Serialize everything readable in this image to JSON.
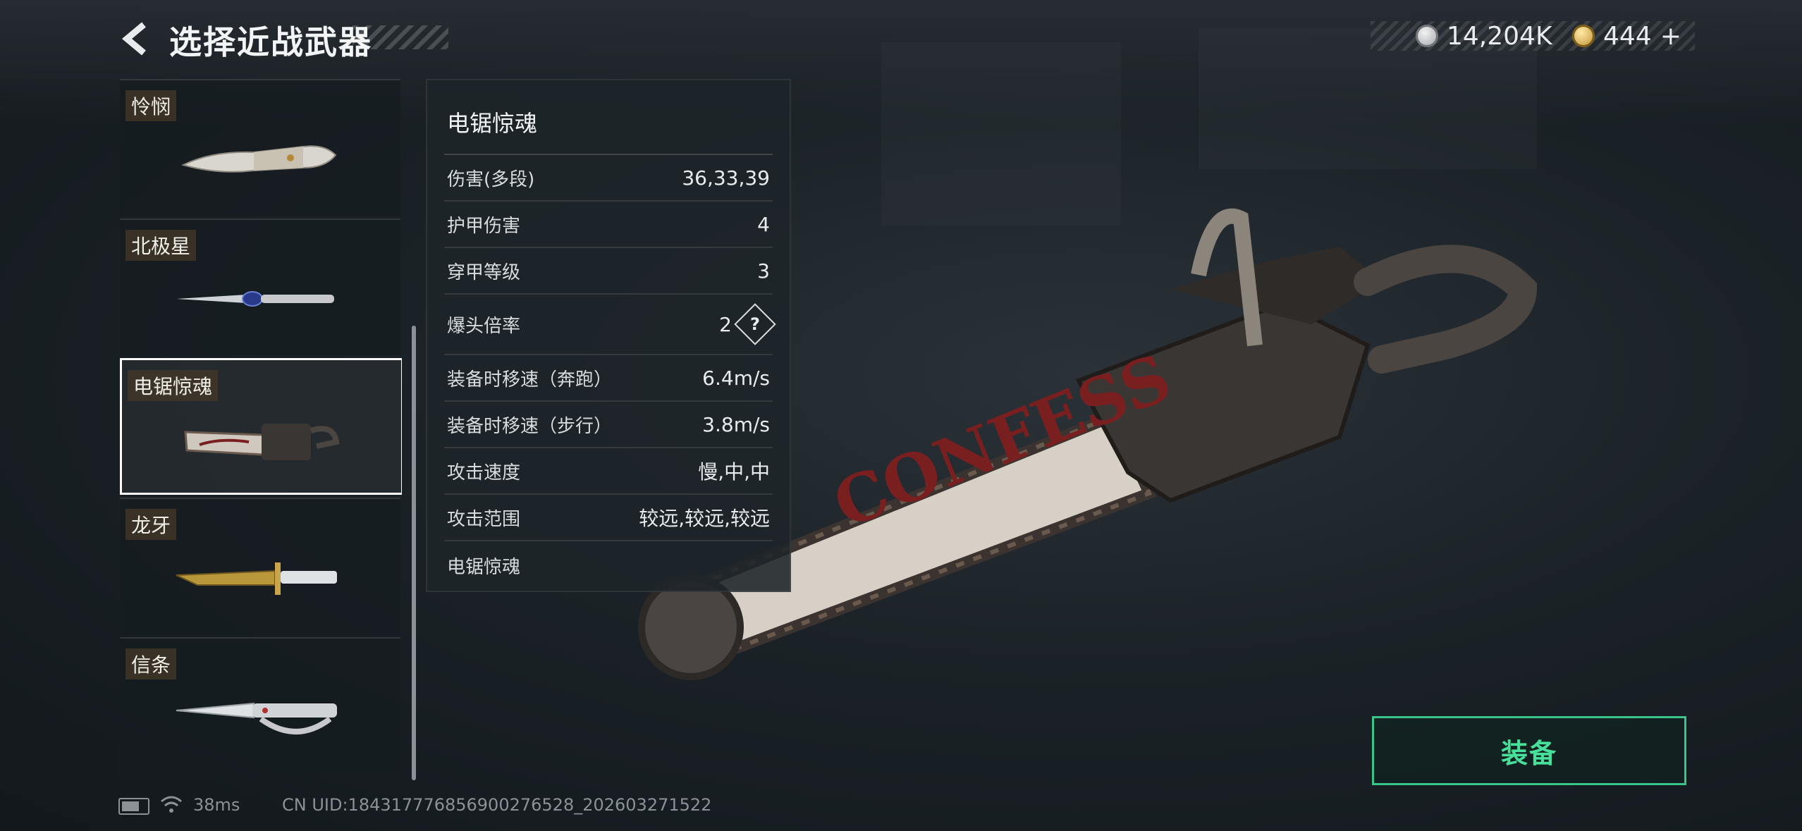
{
  "header": {
    "title": "选择近战武器"
  },
  "currency": {
    "silver": "14,204K",
    "gold": "444",
    "add_label": "+"
  },
  "weapons": [
    {
      "name": "怜悯"
    },
    {
      "name": "北极星"
    },
    {
      "name": "电锯惊魂",
      "selected": true
    },
    {
      "name": "龙牙"
    },
    {
      "name": "信条"
    }
  ],
  "panel": {
    "title": "电锯惊魂",
    "stats": [
      {
        "label": "伤害(多段)",
        "value": "36,33,39"
      },
      {
        "label": "护甲伤害",
        "value": "4"
      },
      {
        "label": "穿甲等级",
        "value": "3"
      },
      {
        "label": "爆头倍率",
        "value": "2",
        "help": "?"
      },
      {
        "label": "装备时移速（奔跑）",
        "value": "6.4m/s"
      },
      {
        "label": "装备时移速（步行）",
        "value": "3.8m/s"
      },
      {
        "label": "攻击速度",
        "value": "慢,中,中"
      },
      {
        "label": "攻击范围",
        "value": "较远,较远,较远"
      }
    ],
    "description": "电锯惊魂"
  },
  "preview": {
    "engraving": "CONFESS"
  },
  "equip": {
    "label": "装备"
  },
  "footer": {
    "ping": "38ms",
    "uid": "CN UID:184317776856900276528_202603271522"
  },
  "colors": {
    "accent_green": "#47e09a",
    "selected_border": "#ffffff"
  }
}
